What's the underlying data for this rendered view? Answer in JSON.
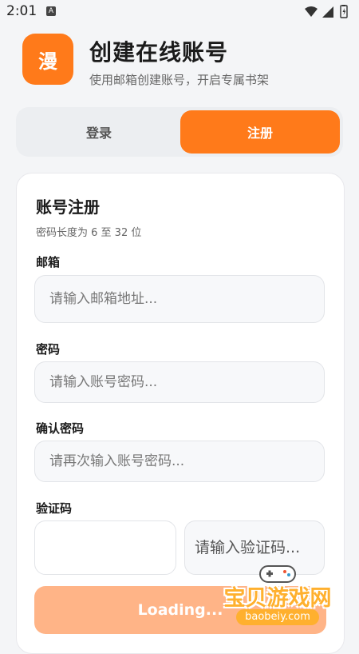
{
  "status_bar": {
    "time": "2:01",
    "notif_glyph": "A"
  },
  "header": {
    "logo_char": "漫",
    "title": "创建在线账号",
    "subtitle": "使用邮箱创建账号，开启专属书架"
  },
  "tabs": [
    {
      "label": "登录",
      "active": false
    },
    {
      "label": "注册",
      "active": true
    }
  ],
  "form": {
    "title": "账号注册",
    "hint": "密码长度为 6 至 32 位",
    "email": {
      "label": "邮箱",
      "placeholder": "请输入邮箱地址...",
      "value": ""
    },
    "password": {
      "label": "密码",
      "placeholder": "请输入账号密码...",
      "value": ""
    },
    "confirm": {
      "label": "确认密码",
      "placeholder": "请再次输入账号密码...",
      "value": ""
    },
    "captcha": {
      "label": "验证码",
      "placeholder": "请输入验证码...",
      "value": ""
    },
    "submit_label": "Loading..."
  },
  "watermark": {
    "text": "宝贝游戏网",
    "url": "baobeiy.com"
  },
  "colors": {
    "accent": "#ff7a1a",
    "accent_disabled": "#ffb487",
    "background": "#f4f5f7"
  }
}
